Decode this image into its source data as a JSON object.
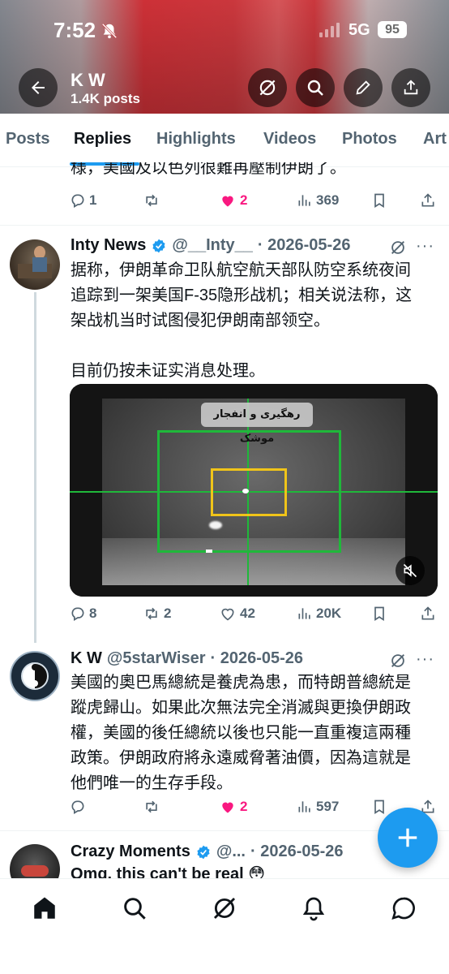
{
  "status_bar": {
    "time": "7:52",
    "network": "5G",
    "battery": "95"
  },
  "header": {
    "name": "K W",
    "posts": "1.4K posts"
  },
  "tabs": [
    {
      "label": "Posts",
      "active": false
    },
    {
      "label": "Replies",
      "active": true
    },
    {
      "label": "Highlights",
      "active": false
    },
    {
      "label": "Videos",
      "active": false
    },
    {
      "label": "Photos",
      "active": false
    },
    {
      "label": "Art",
      "active": false
    }
  ],
  "tweet0": {
    "text_tail": "様，美國及以色列很難再壓制伊朗了。",
    "replies": "1",
    "reposts": "",
    "likes": "2",
    "views": "369"
  },
  "tweet1": {
    "name": "Inty News",
    "handle": "@__Inty__",
    "date": "· 2026-05-26",
    "line1": "据称，伊朗革命卫队航空航天部队防空系统夜间",
    "line2": "追踪到一架美国F-35隐形战机；相关说法称，这",
    "line3": "架战机当时试图侵犯伊朗南部领空。",
    "line4": "目前仍按未证实消息处理。",
    "media_caption": "رهگیری و انفجار موشک",
    "replies": "8",
    "reposts": "2",
    "likes": "42",
    "views": "20K"
  },
  "tweet2": {
    "name": "K W",
    "handle": "@5starWiser",
    "date": "· 2026-05-26",
    "line1": "美國的奧巴馬總統是養虎為患，而特朗普總統是",
    "line2": "蹤虎歸山。如果此次無法完全消滅與更換伊朗政",
    "line3": "權，美國的後任總統以後也只能一直重複這兩種",
    "line4": "政策。伊朗政府將永遠威脅著油價，因為這就是",
    "line5": "他們唯一的生存手段。",
    "replies": "",
    "reposts": "",
    "likes": "2",
    "views": "597"
  },
  "tweet3": {
    "name": "Crazy Moments",
    "handle": "@...",
    "date": "· 2026-05-26",
    "text": "Omg, this can't be real 😳"
  },
  "colors": {
    "accent": "#1d9bf0",
    "like": "#f91880",
    "muted": "#536471",
    "text": "#0f1419"
  }
}
